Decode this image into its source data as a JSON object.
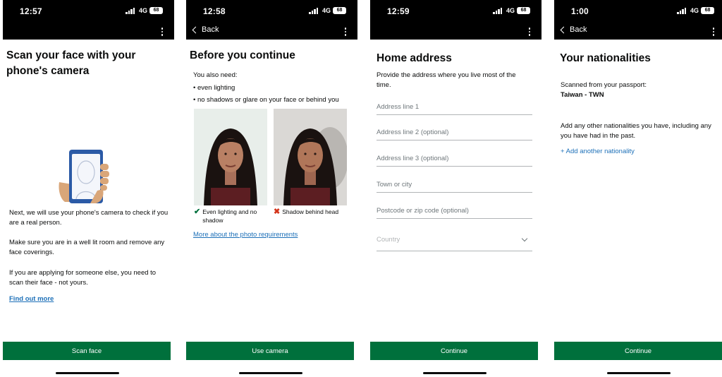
{
  "status": {
    "times": [
      "12:57",
      "12:58",
      "12:59",
      "1:00"
    ],
    "network": "4G",
    "battery": "68"
  },
  "nav": {
    "back_label": "Back"
  },
  "screen1": {
    "title": "Scan your face with your phone's camera",
    "para1": "Next, we will use your phone's camera to check if you are a real person.",
    "para2": "Make sure you are in a well lit room and remove any face coverings.",
    "para3": "If you are applying for someone else, you need to scan their face - not yours.",
    "link": "Find out more",
    "button": "Scan face"
  },
  "screen2": {
    "title": "Before you continue",
    "intro": "You also need:",
    "bullets": [
      "• even lighting",
      "• no shadows or glare on your face or behind you"
    ],
    "good_caption": "Even lighting and no shadow",
    "bad_caption": "Shadow behind head",
    "link": "More about the photo requirements",
    "button": "Use camera",
    "colors": {
      "tick": "#00703c",
      "cross": "#d4351c"
    }
  },
  "screen3": {
    "title": "Home address",
    "intro": "Provide the address where you live most of the time.",
    "fields": {
      "line1": "Address line 1",
      "line2": "Address line 2 (optional)",
      "line3": "Address line 3 (optional)",
      "town": "Town or city",
      "postcode": "Postcode or zip code (optional)",
      "country": "Country"
    },
    "button": "Continue"
  },
  "screen4": {
    "title": "Your nationalities",
    "scanned_label": "Scanned from your passport:",
    "scanned_value": "Taiwan - TWN",
    "para": "Add any other nationalities you have, including any you have had in the past.",
    "link": "+ Add another nationality",
    "button": "Continue"
  },
  "colors": {
    "brand_green": "#00703c",
    "link_blue": "#1d70b8",
    "text": "#0b0c0c"
  }
}
